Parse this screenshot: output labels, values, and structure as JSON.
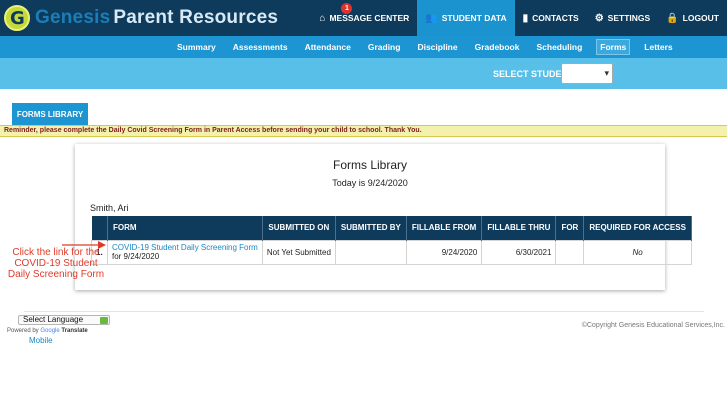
{
  "header": {
    "logo_letter": "G",
    "brand": "Genesis",
    "brand_sub": "Parent Resources",
    "nav": [
      {
        "label": "MESSAGE CENTER",
        "icon": "home-icon",
        "badge": "1"
      },
      {
        "label": "STUDENT DATA",
        "icon": "users-icon"
      },
      {
        "label": "CONTACTS",
        "icon": "book-icon"
      },
      {
        "label": "SETTINGS",
        "icon": "gear-icon"
      },
      {
        "label": "LOGOUT",
        "icon": "lock-icon"
      }
    ]
  },
  "subnav": [
    "Summary",
    "Assessments",
    "Attendance",
    "Grading",
    "Discipline",
    "Gradebook",
    "Scheduling",
    "Forms",
    "Letters"
  ],
  "student_bar": {
    "label": "SELECT STUDENT:"
  },
  "tab": "FORMS LIBRARY",
  "reminder": "Reminder, please complete the Daily Covid Screening Form in Parent Access before sending your child to school. Thank You.",
  "panel": {
    "title": "Forms Library",
    "today": "Today is 9/24/2020",
    "student": "Smith, Ari",
    "columns": [
      "FORM",
      "SUBMITTED ON",
      "SUBMITTED BY",
      "FILLABLE FROM",
      "FILLABLE THRU",
      "FOR",
      "REQUIRED FOR ACCESS"
    ],
    "row": {
      "num": "1.",
      "form_link": "COVID-19 Student Daily Screening Form",
      "form_date": "for 9/24/2020",
      "submitted_on": "Not Yet Submitted",
      "submitted_by": "",
      "fillable_from": "9/24/2020",
      "fillable_thru": "6/30/2021",
      "for": "",
      "required": "No"
    }
  },
  "annotation": "Click the link for the COVID-19 Student Daily Screening Form",
  "footer": {
    "language": "Select Language",
    "powered": "Powered by",
    "google": "Google",
    "translate": "Translate",
    "mobile": "Mobile",
    "copyright": "©Copyright Genesis Educational Services,Inc."
  },
  "colors": {
    "header_bg": "#0e3a5b",
    "subnav_bg": "#1c95d2",
    "student_bar_bg": "#58bfe8",
    "reminder_bg": "#f4f1ad",
    "annotation": "#e03a27"
  }
}
